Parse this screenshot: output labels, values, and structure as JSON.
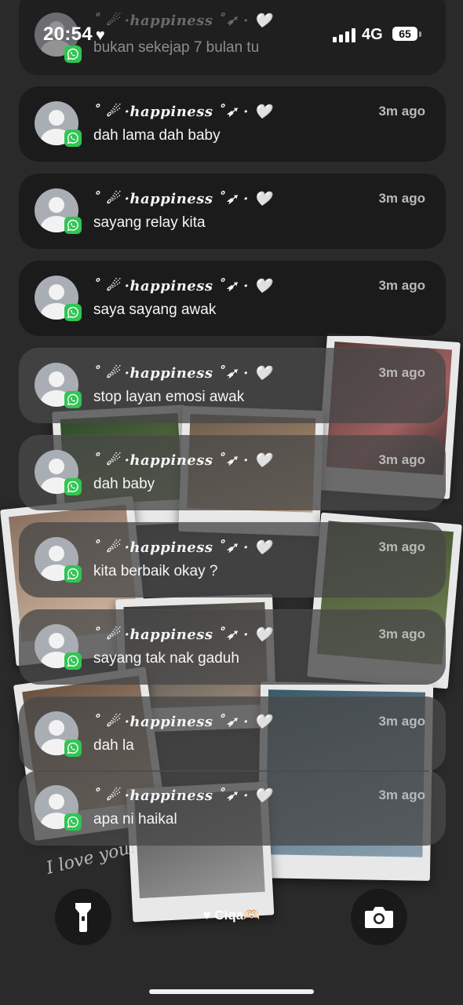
{
  "status_bar": {
    "time": "20:54",
    "time_heart": "♥",
    "network": "4G",
    "battery": "65"
  },
  "notifications": [
    {
      "sender": "˚ ☄ ·𝒉𝒂𝒑𝒑𝒊𝒏𝒆𝒔𝒔 ˚➶ · 🤍",
      "time": "",
      "message": "bukan sekejap 7 bulan tu",
      "style": "top"
    },
    {
      "sender": "˚ ☄ ·𝒉𝒂𝒑𝒑𝒊𝒏𝒆𝒔𝒔 ˚➶ · 🤍",
      "time": "3m ago",
      "message": "dah lama dah baby",
      "style": "dark"
    },
    {
      "sender": "˚ ☄ ·𝒉𝒂𝒑𝒑𝒊𝒏𝒆𝒔𝒔 ˚➶ · 🤍",
      "time": "3m ago",
      "message": "sayang relay kita",
      "style": "dark"
    },
    {
      "sender": "˚ ☄ ·𝒉𝒂𝒑𝒑𝒊𝒏𝒆𝒔𝒔 ˚➶ · 🤍",
      "time": "3m ago",
      "message": "saya sayang awak",
      "style": "dark"
    },
    {
      "sender": "˚ ☄ ·𝒉𝒂𝒑𝒑𝒊𝒏𝒆𝒔𝒔 ˚➶ · 🤍",
      "time": "3m ago",
      "message": "stop layan emosi awak",
      "style": "frost"
    },
    {
      "sender": "˚ ☄ ·𝒉𝒂𝒑𝒑𝒊𝒏𝒆𝒔𝒔 ˚➶ · 🤍",
      "time": "3m ago",
      "message": "dah baby",
      "style": "frost"
    },
    {
      "sender": "˚ ☄ ·𝒉𝒂𝒑𝒑𝒊𝒏𝒆𝒔𝒔 ˚➶ · 🤍",
      "time": "3m ago",
      "message": "kita berbaik okay ?",
      "style": "frost"
    },
    {
      "sender": "˚ ☄ ·𝒉𝒂𝒑𝒑𝒊𝒏𝒆𝒔𝒔 ˚➶ · 🤍",
      "time": "3m ago",
      "message": "sayang tak nak gaduh",
      "style": "frost"
    },
    {
      "sender": "˚ ☄ ·𝒉𝒂𝒑𝒑𝒊𝒏𝒆𝒔𝒔 ˚➶ · 🤍",
      "time": "3m ago",
      "message": "dah la",
      "style": "frost"
    },
    {
      "sender": "˚ ☄ ·𝒉𝒂𝒑𝒑𝒊𝒏𝒆𝒔𝒔 ˚➶ · 🤍",
      "time": "3m ago",
      "message": "apa ni haikal",
      "style": "frost"
    }
  ],
  "lockscreen": {
    "owner_label": "♥ Ciqa🫶🏻",
    "wallpaper_text": "I love you!",
    "flashlight_icon": "flashlight-icon",
    "camera_icon": "camera-icon"
  },
  "colors": {
    "whatsapp_green": "#31c553",
    "card_dark": "#1a1a1a",
    "card_frost": "#484848"
  }
}
